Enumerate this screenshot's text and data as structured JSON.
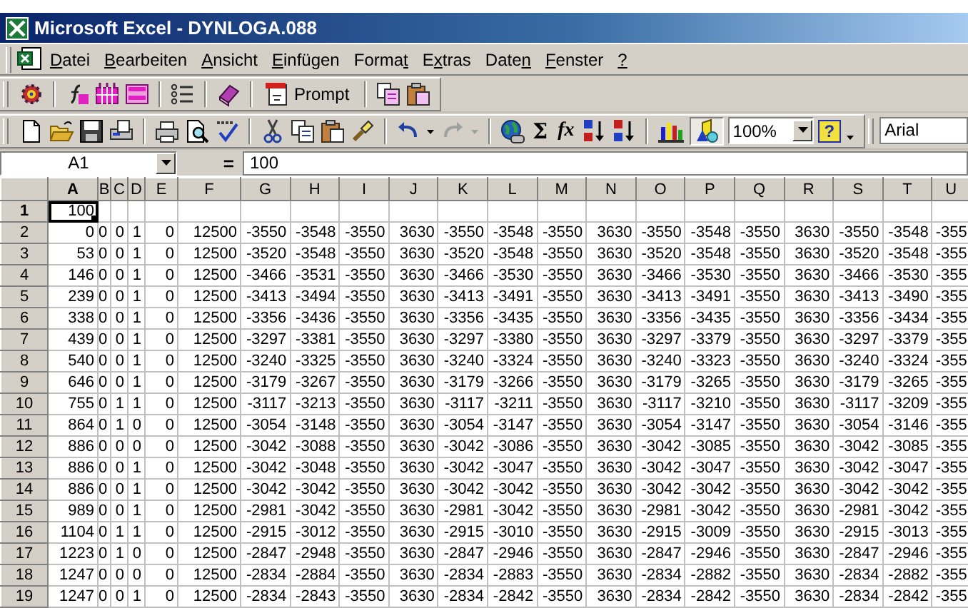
{
  "window": {
    "title": "Microsoft Excel - DYNLOGA.088"
  },
  "menu": [
    {
      "key": "D",
      "after": "atei"
    },
    {
      "key": "B",
      "after": "earbeiten"
    },
    {
      "key": "A",
      "after": "nsicht"
    },
    {
      "key": "E",
      "after": "infügen"
    },
    {
      "before": "Forma",
      "key": "t"
    },
    {
      "before": "E",
      "key": "x",
      "after": "tras"
    },
    {
      "before": "Date",
      "key": "n"
    },
    {
      "key": "F",
      "after": "enster"
    },
    {
      "key": "?"
    }
  ],
  "toolbar1": {
    "prompt": "Prompt"
  },
  "toolbar2": {
    "sum": "Σ",
    "function": "fx",
    "zoom": "100%",
    "help": "?",
    "font": "Arial",
    "redo": {
      "disabled": true
    },
    "drawing": {
      "on": true
    }
  },
  "formula_bar": {
    "name_box": "A1",
    "equals": "=",
    "value": "100"
  },
  "sheet": {
    "columns": [
      {
        "label": "A",
        "selected": true
      },
      {
        "label": "B",
        "selected": false
      },
      {
        "label": "C",
        "selected": false
      },
      {
        "label": "D",
        "selected": false
      },
      {
        "label": "E",
        "selected": false
      },
      {
        "label": "F",
        "selected": false
      },
      {
        "label": "G",
        "selected": false
      },
      {
        "label": "H",
        "selected": false
      },
      {
        "label": "I",
        "selected": false
      },
      {
        "label": "J",
        "selected": false
      },
      {
        "label": "K",
        "selected": false
      },
      {
        "label": "L",
        "selected": false
      },
      {
        "label": "M",
        "selected": false
      },
      {
        "label": "N",
        "selected": false
      },
      {
        "label": "O",
        "selected": false
      },
      {
        "label": "P",
        "selected": false
      },
      {
        "label": "Q",
        "selected": false
      },
      {
        "label": "R",
        "selected": false
      },
      {
        "label": "S",
        "selected": false
      },
      {
        "label": "T",
        "selected": false
      },
      {
        "label": "U",
        "selected": false
      }
    ],
    "rows": [
      {
        "header": "1",
        "selected": true,
        "cells": [
          "100"
        ]
      },
      {
        "header": "2",
        "selected": false,
        "cells": [
          "0",
          "0",
          "0",
          "1",
          "0",
          "12500",
          "-3550",
          "-3548",
          "-3550",
          "3630",
          "-3550",
          "-3548",
          "-3550",
          "3630",
          "-3550",
          "-3548",
          "-3550",
          "3630",
          "-3550",
          "-3548",
          "-355"
        ]
      },
      {
        "header": "3",
        "selected": false,
        "cells": [
          "53",
          "0",
          "0",
          "1",
          "0",
          "12500",
          "-3520",
          "-3548",
          "-3550",
          "3630",
          "-3520",
          "-3548",
          "-3550",
          "3630",
          "-3520",
          "-3548",
          "-3550",
          "3630",
          "-3520",
          "-3548",
          "-355"
        ]
      },
      {
        "header": "4",
        "selected": false,
        "cells": [
          "146",
          "0",
          "0",
          "1",
          "0",
          "12500",
          "-3466",
          "-3531",
          "-3550",
          "3630",
          "-3466",
          "-3530",
          "-3550",
          "3630",
          "-3466",
          "-3530",
          "-3550",
          "3630",
          "-3466",
          "-3530",
          "-355"
        ]
      },
      {
        "header": "5",
        "selected": false,
        "cells": [
          "239",
          "0",
          "0",
          "1",
          "0",
          "12500",
          "-3413",
          "-3494",
          "-3550",
          "3630",
          "-3413",
          "-3491",
          "-3550",
          "3630",
          "-3413",
          "-3491",
          "-3550",
          "3630",
          "-3413",
          "-3490",
          "-355"
        ]
      },
      {
        "header": "6",
        "selected": false,
        "cells": [
          "338",
          "0",
          "0",
          "1",
          "0",
          "12500",
          "-3356",
          "-3436",
          "-3550",
          "3630",
          "-3356",
          "-3435",
          "-3550",
          "3630",
          "-3356",
          "-3435",
          "-3550",
          "3630",
          "-3356",
          "-3434",
          "-355"
        ]
      },
      {
        "header": "7",
        "selected": false,
        "cells": [
          "439",
          "0",
          "0",
          "1",
          "0",
          "12500",
          "-3297",
          "-3381",
          "-3550",
          "3630",
          "-3297",
          "-3380",
          "-3550",
          "3630",
          "-3297",
          "-3379",
          "-3550",
          "3630",
          "-3297",
          "-3379",
          "-355"
        ]
      },
      {
        "header": "8",
        "selected": false,
        "cells": [
          "540",
          "0",
          "0",
          "1",
          "0",
          "12500",
          "-3240",
          "-3325",
          "-3550",
          "3630",
          "-3240",
          "-3324",
          "-3550",
          "3630",
          "-3240",
          "-3323",
          "-3550",
          "3630",
          "-3240",
          "-3324",
          "-355"
        ]
      },
      {
        "header": "9",
        "selected": false,
        "cells": [
          "646",
          "0",
          "0",
          "1",
          "0",
          "12500",
          "-3179",
          "-3267",
          "-3550",
          "3630",
          "-3179",
          "-3266",
          "-3550",
          "3630",
          "-3179",
          "-3265",
          "-3550",
          "3630",
          "-3179",
          "-3265",
          "-355"
        ]
      },
      {
        "header": "10",
        "selected": false,
        "cells": [
          "755",
          "0",
          "1",
          "1",
          "0",
          "12500",
          "-3117",
          "-3213",
          "-3550",
          "3630",
          "-3117",
          "-3211",
          "-3550",
          "3630",
          "-3117",
          "-3210",
          "-3550",
          "3630",
          "-3117",
          "-3209",
          "-355"
        ]
      },
      {
        "header": "11",
        "selected": false,
        "cells": [
          "864",
          "0",
          "1",
          "0",
          "0",
          "12500",
          "-3054",
          "-3148",
          "-3550",
          "3630",
          "-3054",
          "-3147",
          "-3550",
          "3630",
          "-3054",
          "-3147",
          "-3550",
          "3630",
          "-3054",
          "-3146",
          "-355"
        ]
      },
      {
        "header": "12",
        "selected": false,
        "cells": [
          "886",
          "0",
          "0",
          "0",
          "0",
          "12500",
          "-3042",
          "-3088",
          "-3550",
          "3630",
          "-3042",
          "-3086",
          "-3550",
          "3630",
          "-3042",
          "-3085",
          "-3550",
          "3630",
          "-3042",
          "-3085",
          "-355"
        ]
      },
      {
        "header": "13",
        "selected": false,
        "cells": [
          "886",
          "0",
          "0",
          "1",
          "0",
          "12500",
          "-3042",
          "-3048",
          "-3550",
          "3630",
          "-3042",
          "-3047",
          "-3550",
          "3630",
          "-3042",
          "-3047",
          "-3550",
          "3630",
          "-3042",
          "-3047",
          "-355"
        ]
      },
      {
        "header": "14",
        "selected": false,
        "cells": [
          "886",
          "0",
          "0",
          "1",
          "0",
          "12500",
          "-3042",
          "-3042",
          "-3550",
          "3630",
          "-3042",
          "-3042",
          "-3550",
          "3630",
          "-3042",
          "-3042",
          "-3550",
          "3630",
          "-3042",
          "-3042",
          "-355"
        ]
      },
      {
        "header": "15",
        "selected": false,
        "cells": [
          "989",
          "0",
          "0",
          "1",
          "0",
          "12500",
          "-2981",
          "-3042",
          "-3550",
          "3630",
          "-2981",
          "-3042",
          "-3550",
          "3630",
          "-2981",
          "-3042",
          "-3550",
          "3630",
          "-2981",
          "-3042",
          "-355"
        ]
      },
      {
        "header": "16",
        "selected": false,
        "cells": [
          "1104",
          "0",
          "1",
          "1",
          "0",
          "12500",
          "-2915",
          "-3012",
          "-3550",
          "3630",
          "-2915",
          "-3010",
          "-3550",
          "3630",
          "-2915",
          "-3009",
          "-3550",
          "3630",
          "-2915",
          "-3013",
          "-355"
        ]
      },
      {
        "header": "17",
        "selected": false,
        "cells": [
          "1223",
          "0",
          "1",
          "0",
          "0",
          "12500",
          "-2847",
          "-2948",
          "-3550",
          "3630",
          "-2847",
          "-2946",
          "-3550",
          "3630",
          "-2847",
          "-2946",
          "-3550",
          "3630",
          "-2847",
          "-2946",
          "-355"
        ]
      },
      {
        "header": "18",
        "selected": false,
        "cells": [
          "1247",
          "0",
          "0",
          "0",
          "0",
          "12500",
          "-2834",
          "-2884",
          "-3550",
          "3630",
          "-2834",
          "-2883",
          "-3550",
          "3630",
          "-2834",
          "-2882",
          "-3550",
          "3630",
          "-2834",
          "-2882",
          "-355"
        ]
      },
      {
        "header": "19",
        "selected": false,
        "cells": [
          "1247",
          "0",
          "0",
          "1",
          "0",
          "12500",
          "-2834",
          "-2843",
          "-3550",
          "3630",
          "-2834",
          "-2842",
          "-3550",
          "3630",
          "-2834",
          "-2842",
          "-3550",
          "3630",
          "-2834",
          "-2842",
          "-355"
        ]
      }
    ]
  }
}
